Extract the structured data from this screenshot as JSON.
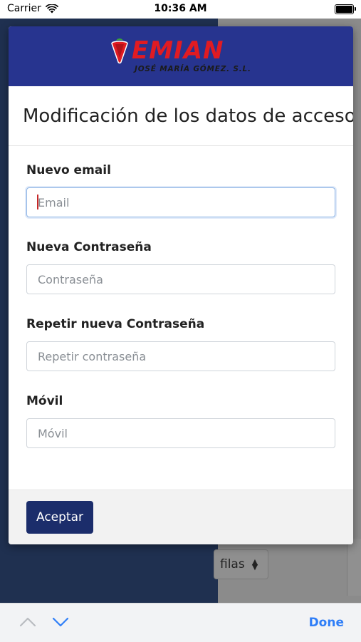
{
  "status_bar": {
    "carrier": "Carrier",
    "time": "10:36 AM",
    "icons": [
      "wifi-icon",
      "battery-icon"
    ]
  },
  "background": {
    "rows_select_label": "filas"
  },
  "modal": {
    "logo": {
      "brand": "EMIAN",
      "tagline": "JOSÉ MARÍA GÓMEZ. S.L."
    },
    "title": "Modificación de los datos de acceso",
    "fields": [
      {
        "label": "Nuevo email",
        "placeholder": "Email",
        "value": ""
      },
      {
        "label": "Nueva Contraseña",
        "placeholder": "Contraseña",
        "value": ""
      },
      {
        "label": "Repetir nueva Contraseña",
        "placeholder": "Repetir contraseña",
        "value": ""
      },
      {
        "label": "Móvil",
        "placeholder": "Móvil",
        "value": ""
      }
    ],
    "accept_label": "Aceptar"
  },
  "keyboard_accessory": {
    "done_label": "Done"
  },
  "colors": {
    "header_blue": "#27348f",
    "brand_red": "#e11b22",
    "button_navy": "#1b2d6b",
    "done_blue": "#2f7ef7"
  }
}
